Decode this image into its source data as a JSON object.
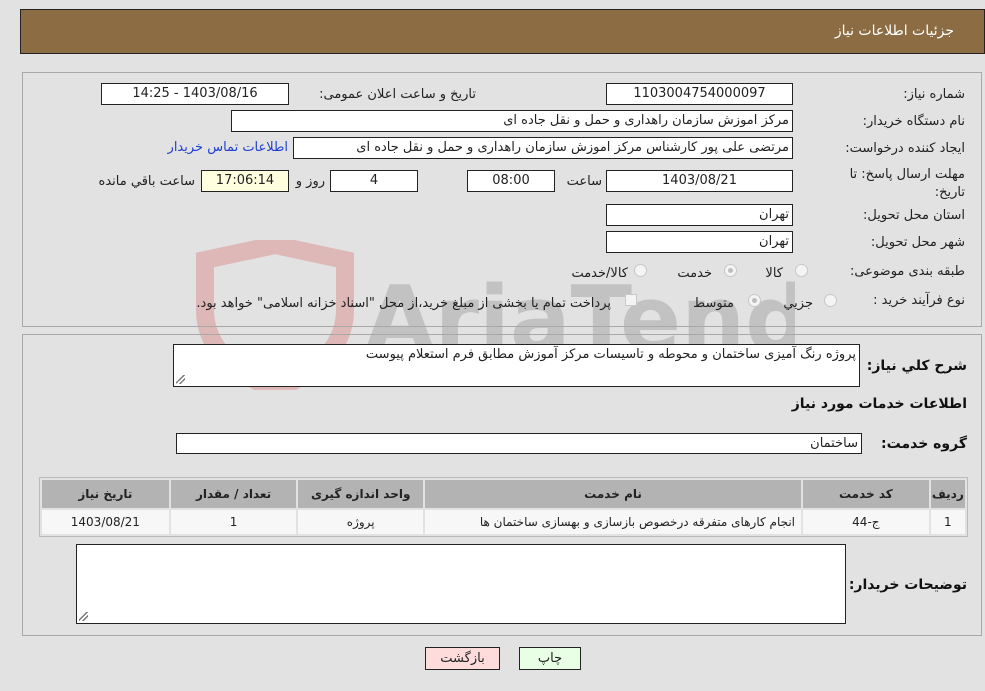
{
  "header": {
    "title": "جزئیات اطلاعات نیاز"
  },
  "form": {
    "need_number": {
      "label": "شماره نیاز:",
      "value": "1103004754000097"
    },
    "announce_datetime": {
      "label": "تاریخ و ساعت اعلان عمومی:",
      "value": "1403/08/16 - 14:25"
    },
    "buyer_org": {
      "label": "نام دستگاه خریدار:",
      "value": "مرکز اموزش سازمان راهداری و حمل و نقل جاده ای"
    },
    "creator": {
      "label": "ایجاد کننده درخواست:",
      "value": "مرتضی علی پور کارشناس مرکز اموزش سازمان راهداری و حمل و نقل جاده ای",
      "contact_link": "اطلاعات تماس خریدار"
    },
    "deadline": {
      "label": "مهلت ارسال پاسخ: تا تاریخ:",
      "date": "1403/08/21",
      "time_label": "ساعت",
      "time": "08:00",
      "days": "4",
      "days_label": "روز و",
      "remaining": "17:06:14",
      "remaining_label": "ساعت باقي مانده"
    },
    "province": {
      "label": "استان محل تحویل:",
      "value": "تهران"
    },
    "city": {
      "label": "شهر محل تحویل:",
      "value": "تهران"
    },
    "category": {
      "label": "طبقه بندی موضوعی:",
      "options": [
        "کالا",
        "خدمت",
        "کالا/خدمت"
      ],
      "selected": "خدمت"
    },
    "purchase_type": {
      "label": "نوع فرآیند خرید :",
      "options": [
        "جزيي",
        "متوسط"
      ],
      "selected": "متوسط",
      "treasury_note": "پرداخت تمام یا بخشی از مبلغ خرید،از محل \"اسناد خزانه اسلامی\" خواهد بود."
    }
  },
  "description": {
    "label": "شرح كلي نياز:",
    "value": "پروژه رنگ آمیزی ساختمان و محوطه و تاسیسات مرکز آموزش مطابق فرم استعلام پیوست"
  },
  "services": {
    "section_title": "اطلاعات خدمات مورد نیاز",
    "group_label": "گروه خدمت:",
    "group_value": "ساختمان",
    "columns": [
      "ردیف",
      "کد خدمت",
      "نام خدمت",
      "واحد اندازه گیری",
      "تعداد / مقدار",
      "تاریخ نیاز"
    ],
    "rows": [
      {
        "row": "1",
        "code": "ج-44",
        "name": "انجام کارهای متفرقه درخصوص بازسازی و بهسازی ساختمان ها",
        "unit": "پروژه",
        "qty": "1",
        "date": "1403/08/21"
      }
    ]
  },
  "buyer_notes": {
    "label": "توضیحات خریدار:",
    "value": ""
  },
  "buttons": {
    "print": "چاپ",
    "back": "بازگشت"
  },
  "watermark": {
    "text": "AriaTender.neT"
  }
}
